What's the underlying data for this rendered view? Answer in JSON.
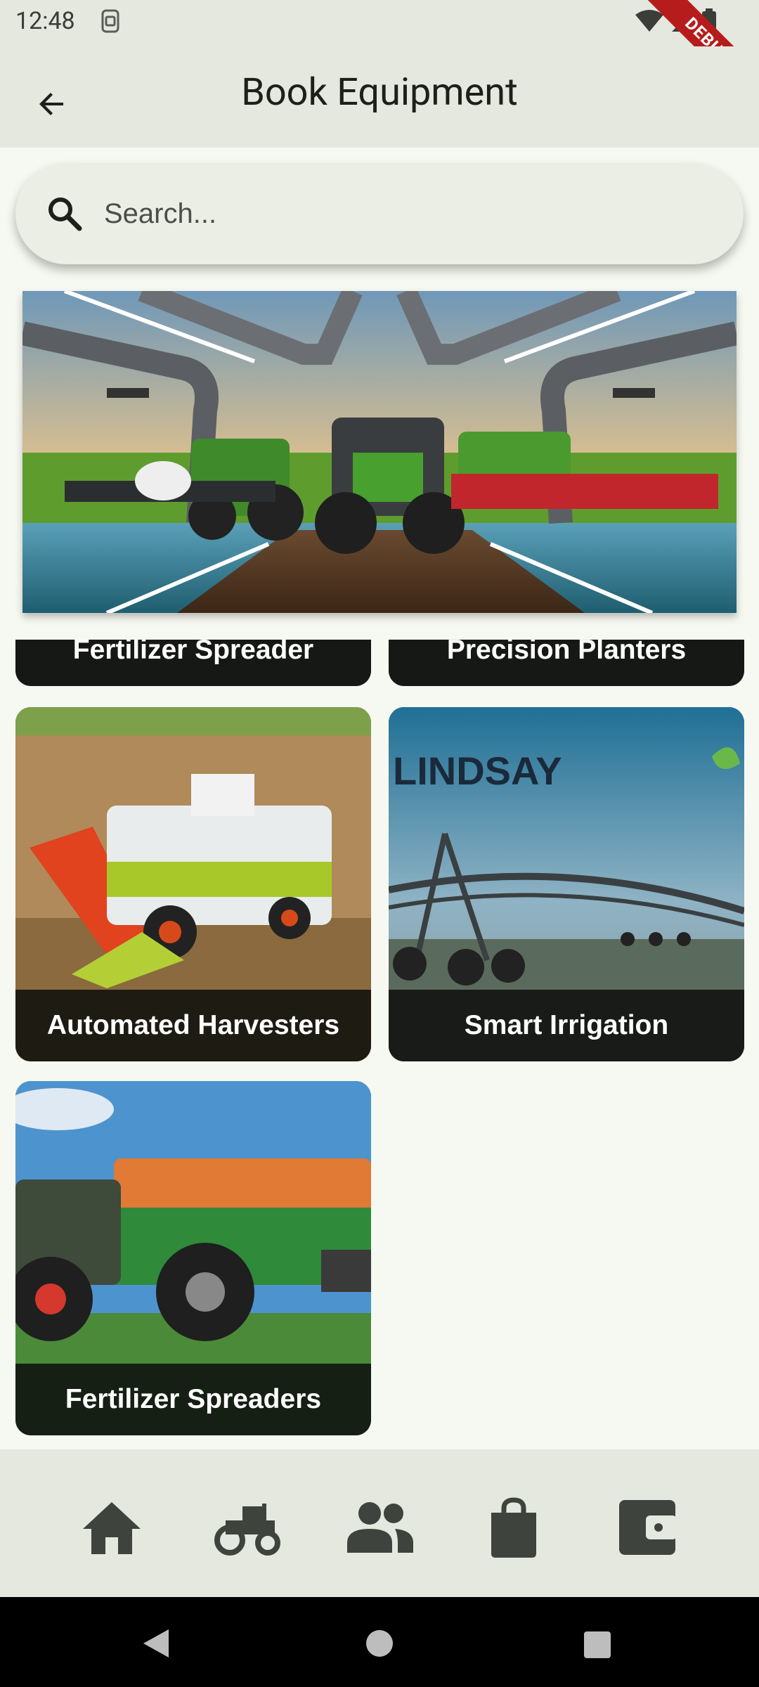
{
  "status_bar": {
    "time": "12:48",
    "debug_label": "DEBUG"
  },
  "app_bar": {
    "title": "Book Equipment"
  },
  "search": {
    "placeholder": "Search..."
  },
  "equipment": [
    {
      "label": "Fertilizer Spreader"
    },
    {
      "label": "Precision Planters"
    },
    {
      "label": "Automated Harvesters"
    },
    {
      "label": "Smart Irrigation"
    },
    {
      "label": "Fertilizer Spreaders"
    }
  ],
  "banner_brand_text": "LINDSAY",
  "bottom_nav": [
    "home-icon",
    "tractor-icon",
    "people-icon",
    "shopping-bag-icon",
    "wallet-icon"
  ],
  "colors": {
    "background": "#f6f9f1",
    "bars": "#e4e8df",
    "label_overlay": "#0f100e"
  }
}
